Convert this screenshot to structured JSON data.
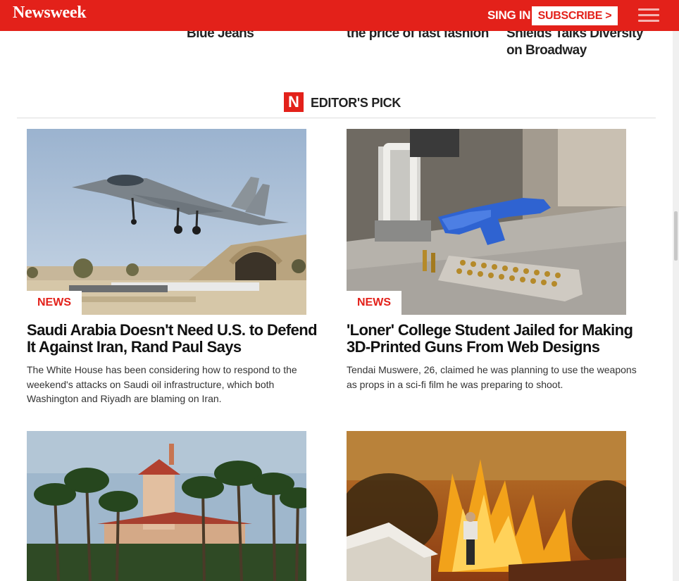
{
  "header": {
    "logo": "Newsweek",
    "signin": "SING IN",
    "subscribe": "SUBSCRIBE >",
    "menu_icon": "hamburger-icon"
  },
  "top_stories": [
    {
      "text": "Blue Jeans"
    },
    {
      "text": "the price of fast fashion"
    },
    {
      "text": "Shields Talks Diversity on Broadway"
    }
  ],
  "editors_pick": {
    "icon_letter": "N",
    "label": "EDITOR'S PICK"
  },
  "articles": [
    {
      "category": "NEWS",
      "headline": "Saudi Arabia Doesn't Need U.S. to Defend It Against Iran, Rand Paul Says",
      "summary": "The White House has been considering how to respond to the weekend's attacks on Saudi oil infrastructure, which both Washington and Riyadh are blaming on Iran.",
      "image": "fighter-jet-photo"
    },
    {
      "category": "NEWS",
      "headline": "'Loner' College Student Jailed for Making 3D-Printed Guns From Web Designs",
      "summary": "Tendai Muswere, 26, claimed he was planning to use the weapons as props in a sci-fi film he was preparing to shoot.",
      "image": "3d-printed-gun-photo"
    },
    {
      "image": "mar-a-lago-photo"
    },
    {
      "image": "wildfire-photo"
    }
  ],
  "colors": {
    "brand": "#e3211a"
  }
}
